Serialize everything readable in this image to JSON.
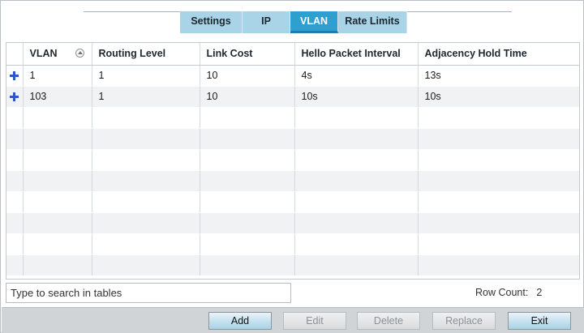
{
  "tabs": [
    {
      "label": "Settings",
      "active": false
    },
    {
      "label": "IP",
      "active": false
    },
    {
      "label": "VLAN",
      "active": true
    },
    {
      "label": "Rate Limits",
      "active": false
    }
  ],
  "table": {
    "columns": [
      "VLAN",
      "Routing Level",
      "Link Cost",
      "Hello Packet Interval",
      "Adjacency Hold Time"
    ],
    "sort_column": "VLAN",
    "rows": [
      {
        "vlan": "1",
        "routing_level": "1",
        "link_cost": "10",
        "hello_packet_interval": "4s",
        "adjacency_hold_time": "13s"
      },
      {
        "vlan": "103",
        "routing_level": "1",
        "link_cost": "10",
        "hello_packet_interval": "10s",
        "adjacency_hold_time": "10s"
      }
    ]
  },
  "search": {
    "placeholder": "Type to search in tables",
    "value": ""
  },
  "row_count": {
    "label": "Row Count:",
    "value": "2"
  },
  "buttons": {
    "add": {
      "label": "Add",
      "enabled": true
    },
    "edit": {
      "label": "Edit",
      "enabled": false
    },
    "delete": {
      "label": "Delete",
      "enabled": false
    },
    "replace": {
      "label": "Replace",
      "enabled": false
    },
    "exit": {
      "label": "Exit",
      "enabled": true
    }
  },
  "icons": {
    "sort": "sort-ascending-icon",
    "row_expand": "plus-icon"
  },
  "colors": {
    "tab_active": "#2f9fd0",
    "tab_inactive": "#a9d3e6",
    "expand_plus": "#2a58c8"
  }
}
